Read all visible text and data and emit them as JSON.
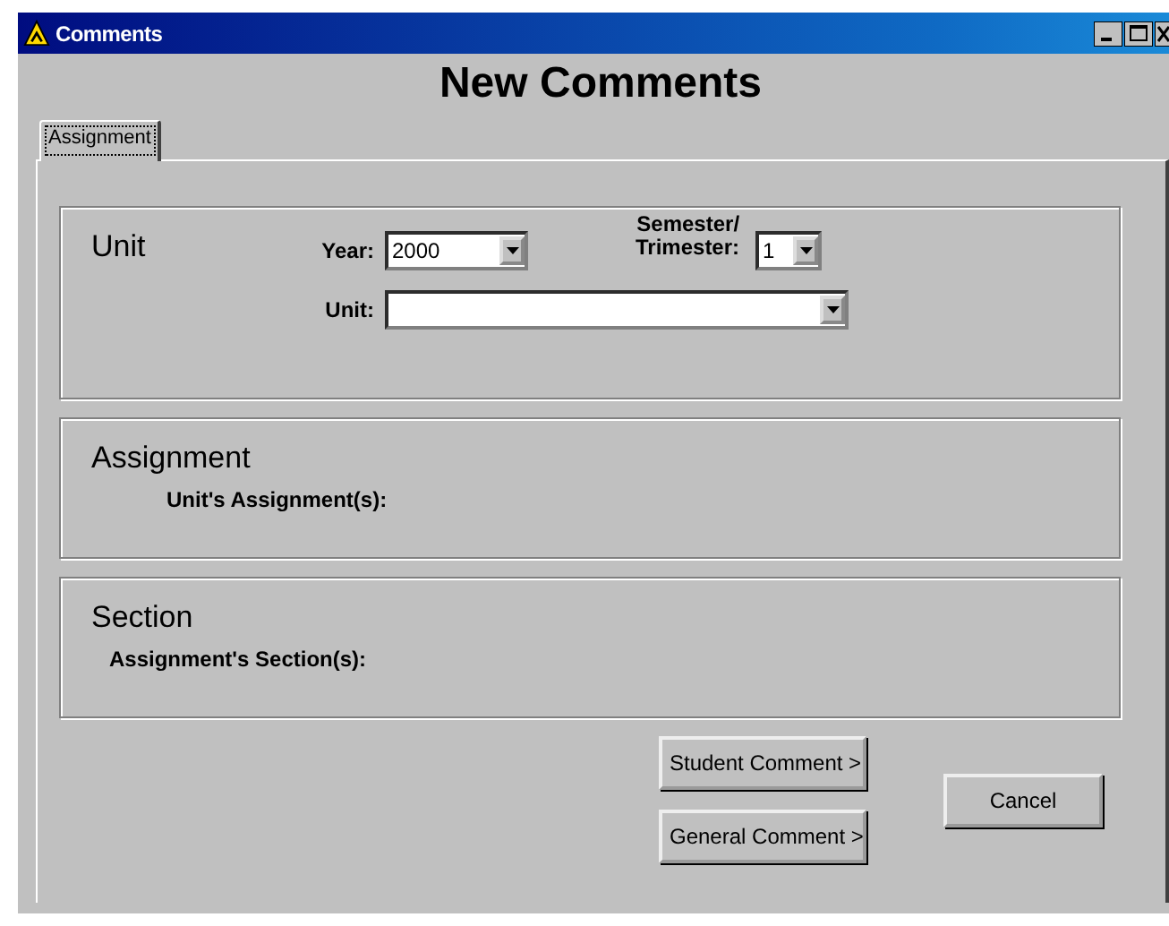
{
  "window": {
    "title": "Comments"
  },
  "heading": "New Comments",
  "tabs": [
    {
      "label": "Assignment",
      "selected": true
    }
  ],
  "unit_group": {
    "title": "Unit",
    "year": {
      "label": "Year:",
      "value": "2000"
    },
    "semester": {
      "label_lines": [
        "Semester/",
        "Trimester:"
      ],
      "value": "1"
    },
    "unit": {
      "label": "Unit:"
    }
  },
  "assignment_group": {
    "title": "Assignment",
    "label": "Unit's Assignment(s):"
  },
  "section_group": {
    "title": "Section",
    "label": "Assignment's Section(s):"
  },
  "buttons": [
    {
      "label": "Student Comment >"
    },
    {
      "label": "General Comment >"
    }
  ],
  "cancel_button": "Cancel"
}
